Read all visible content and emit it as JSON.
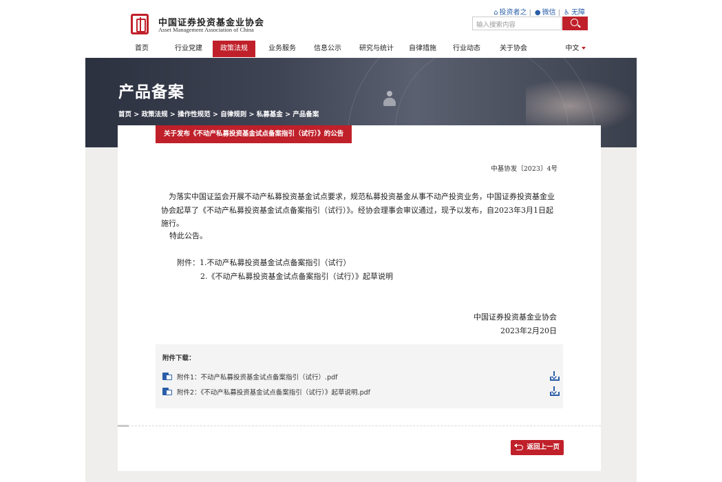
{
  "header": {
    "org_name_cn": "中国证券投资基金业协会",
    "org_name_en": "Asset Management Association of China",
    "links": {
      "investor": "投资者之",
      "wechat": "微信",
      "accessibility": "无障"
    },
    "search_placeholder": "输入搜索内容",
    "search_icon": "search-icon"
  },
  "nav": {
    "items": [
      {
        "label": "首页",
        "active": false
      },
      {
        "label": "行业党建",
        "active": false
      },
      {
        "label": "政策法规",
        "active": true
      },
      {
        "label": "业务服务",
        "active": false
      },
      {
        "label": "信息公示",
        "active": false
      },
      {
        "label": "研究与统计",
        "active": false
      },
      {
        "label": "自律措施",
        "active": false
      },
      {
        "label": "行业动态",
        "active": false
      },
      {
        "label": "关于协会",
        "active": false
      }
    ],
    "language": "中文"
  },
  "banner": {
    "title": "产品备案",
    "breadcrumb": "首页 > 政策法规 > 操作性规范 > 自律规则 > 私募基金 > 产品备案"
  },
  "article": {
    "title": "关于发布《不动产私募投资基金试点备案指引（试行）》的公告",
    "doc_no": "中基协发〔2023〕4号",
    "paragraph1": "为落实中国证监会开展不动产私募投资基金试点要求，规范私募投资基金从事不动产投资业务，中国证券投资基金业协会起草了《不动产私募投资基金试点备案指引（试行）》。经协会理事会审议通过，现予以发布，自2023年3月1日起施行。",
    "paragraph2": "特此公告。",
    "attachment_line1": "附件：1.不动产私募投资基金试点备案指引（试行）",
    "attachment_line2": "2.《不动产私募投资基金试点备案指引（试行）》起草说明",
    "signature_org": "中国证券投资基金业协会",
    "signature_date": "2023年2月20日"
  },
  "downloads": {
    "title": "附件下载：",
    "files": [
      {
        "name": "附件1：不动产私募投资基金试点备案指引（试行）.pdf"
      },
      {
        "name": "附件2：《不动产私募投资基金试点备案指引（试行）》起草说明.pdf"
      }
    ]
  },
  "back_button": "返回上一页",
  "colors": {
    "brand_red": "#c0202a",
    "link_blue": "#2a5ea8"
  }
}
